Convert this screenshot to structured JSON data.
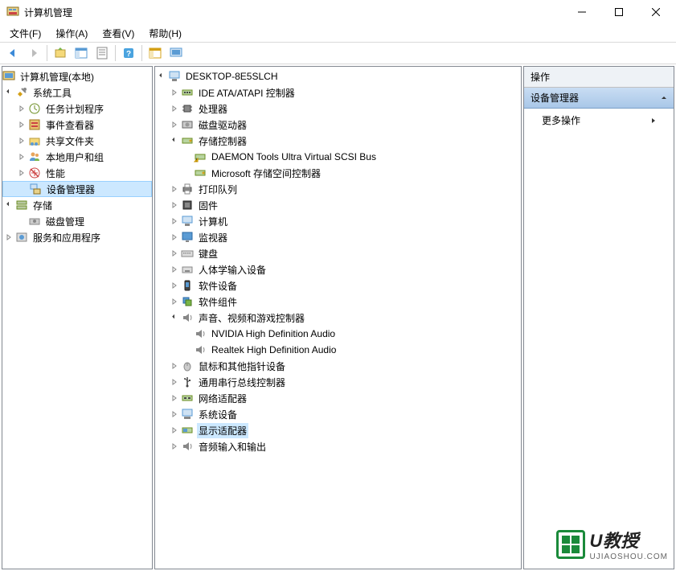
{
  "window": {
    "title": "计算机管理"
  },
  "menu": {
    "file": "文件(F)",
    "action": "操作(A)",
    "view": "查看(V)",
    "help": "帮助(H)"
  },
  "left_tree": {
    "root": "计算机管理(本地)",
    "system_tools": "系统工具",
    "task_scheduler": "任务计划程序",
    "event_viewer": "事件查看器",
    "shared_folders": "共享文件夹",
    "local_users": "本地用户和组",
    "performance": "性能",
    "device_manager": "设备管理器",
    "storage": "存储",
    "disk_management": "磁盘管理",
    "services_apps": "服务和应用程序"
  },
  "center_tree": {
    "computer": "DESKTOP-8E5SLCH",
    "ide": "IDE ATA/ATAPI 控制器",
    "cpu": "处理器",
    "disk_drives": "磁盘驱动器",
    "storage_ctrl": "存储控制器",
    "daemon": "DAEMON Tools Ultra Virtual SCSI Bus",
    "ms_storage": "Microsoft 存储空间控制器",
    "print_queue": "打印队列",
    "firmware": "固件",
    "computer_node": "计算机",
    "monitors": "监视器",
    "keyboard": "键盘",
    "hid": "人体学输入设备",
    "software_dev": "软件设备",
    "software_comp": "软件组件",
    "audio": "声音、视频和游戏控制器",
    "nvidia_audio": "NVIDIA High Definition Audio",
    "realtek_audio": "Realtek High Definition Audio",
    "mouse": "鼠标和其他指针设备",
    "usb": "通用串行总线控制器",
    "network": "网络适配器",
    "system_dev": "系统设备",
    "display": "显示适配器",
    "audio_io": "音频输入和输出"
  },
  "right_panel": {
    "header": "操作",
    "section": "设备管理器",
    "more_actions": "更多操作"
  },
  "watermark": {
    "title": "U教授",
    "url": "UJIAOSHOU.COM"
  }
}
